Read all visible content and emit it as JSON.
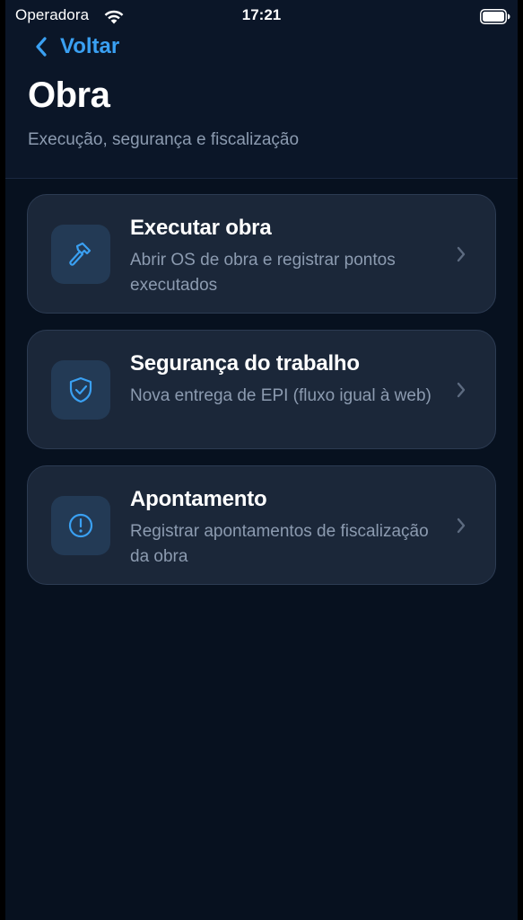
{
  "status_bar": {
    "carrier": "Operadora",
    "time": "17:21",
    "wifi_icon": "wifi-icon",
    "battery_icon": "battery-icon"
  },
  "nav": {
    "back_label": "Voltar",
    "back_icon": "chevron-left-icon"
  },
  "page": {
    "title": "Obra",
    "subtitle": "Execução, segurança e fiscalização"
  },
  "colors": {
    "accent": "#3aa0f2",
    "background": "#07111f",
    "card": "#1b2739",
    "icon_box": "#233a55"
  },
  "menu": {
    "items": [
      {
        "icon": "hammer-icon",
        "title": "Executar obra",
        "description": "Abrir OS de obra e registrar pontos executados"
      },
      {
        "icon": "shield-check-icon",
        "title": "Segurança do trabalho",
        "description": "Nova entrega de EPI (fluxo igual à web)"
      },
      {
        "icon": "alert-circle-icon",
        "title": "Apontamento",
        "description": "Registrar apontamentos de fiscalização da obra"
      }
    ]
  }
}
